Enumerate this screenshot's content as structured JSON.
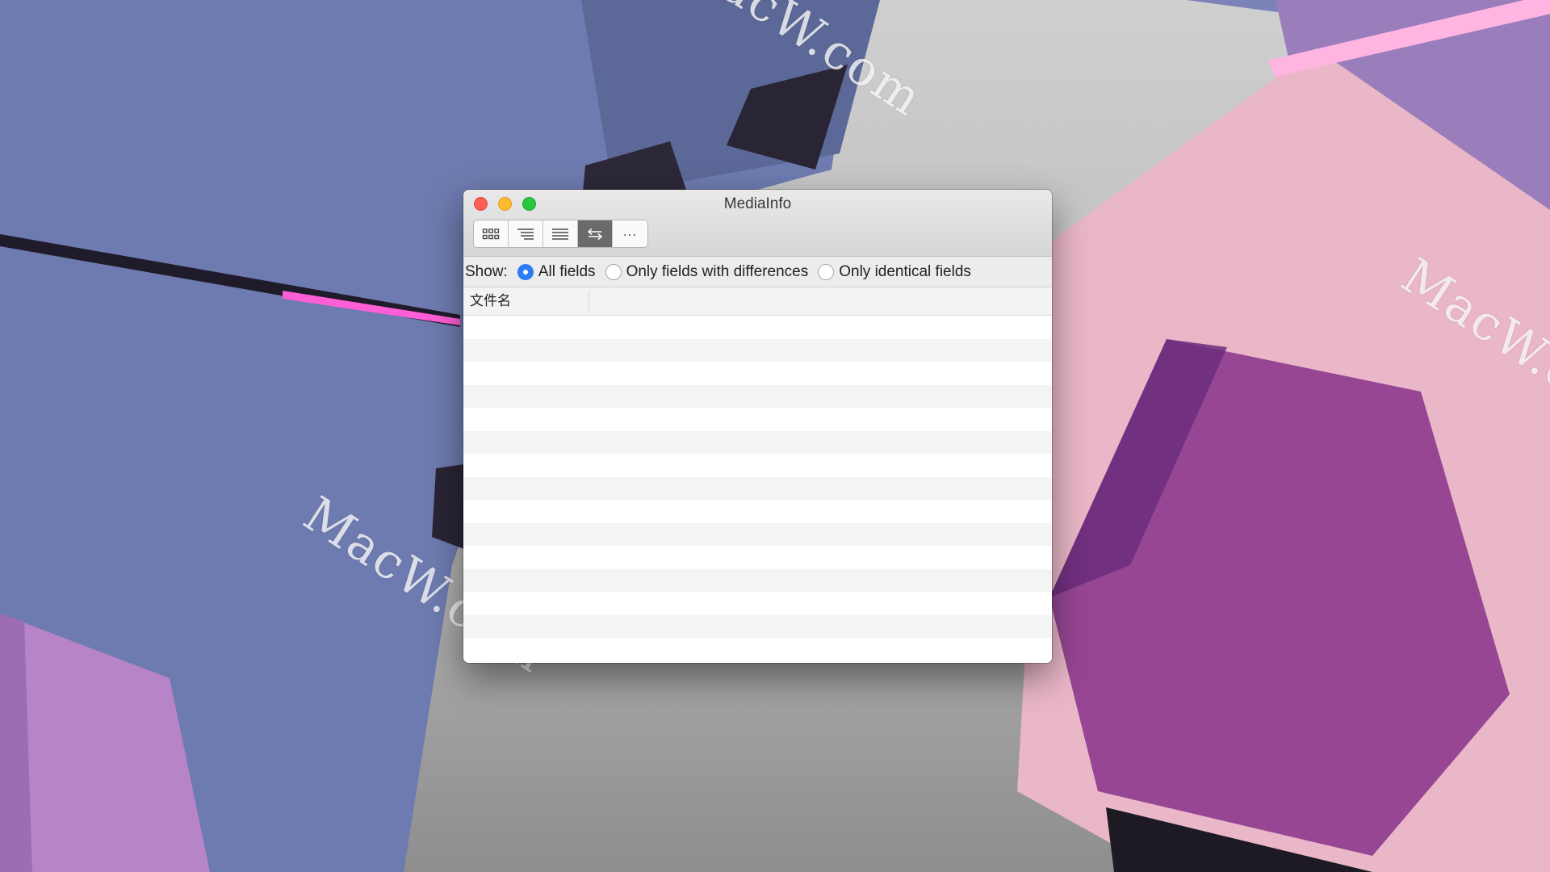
{
  "window": {
    "title": "MediaInfo",
    "controls": [
      "close",
      "minimize",
      "maximize"
    ]
  },
  "toolbar": {
    "buttons": [
      {
        "icon": "grid-view-icon",
        "active": false
      },
      {
        "icon": "tree-view-icon",
        "active": false
      },
      {
        "icon": "text-view-icon",
        "active": false
      },
      {
        "icon": "compare-view-icon",
        "active": true
      },
      {
        "icon": "more-icon",
        "label": "...",
        "active": false
      }
    ]
  },
  "show_filter": {
    "label": "Show:",
    "options": [
      {
        "label": "All fields",
        "selected": true
      },
      {
        "label": "Only fields with differences",
        "selected": false
      },
      {
        "label": "Only identical fields",
        "selected": false
      }
    ]
  },
  "table": {
    "columns": [
      "文件名"
    ],
    "rows": []
  },
  "watermarks": [
    "MacW.com",
    "MacW.com",
    "MacW.com"
  ],
  "colors": {
    "selected_radio": "#2d7cf6",
    "active_toolbar_button": "#6a6a6a",
    "close_button": "#fc5f57",
    "minimize_button": "#fdbc2e",
    "maximize_button": "#28c840"
  }
}
